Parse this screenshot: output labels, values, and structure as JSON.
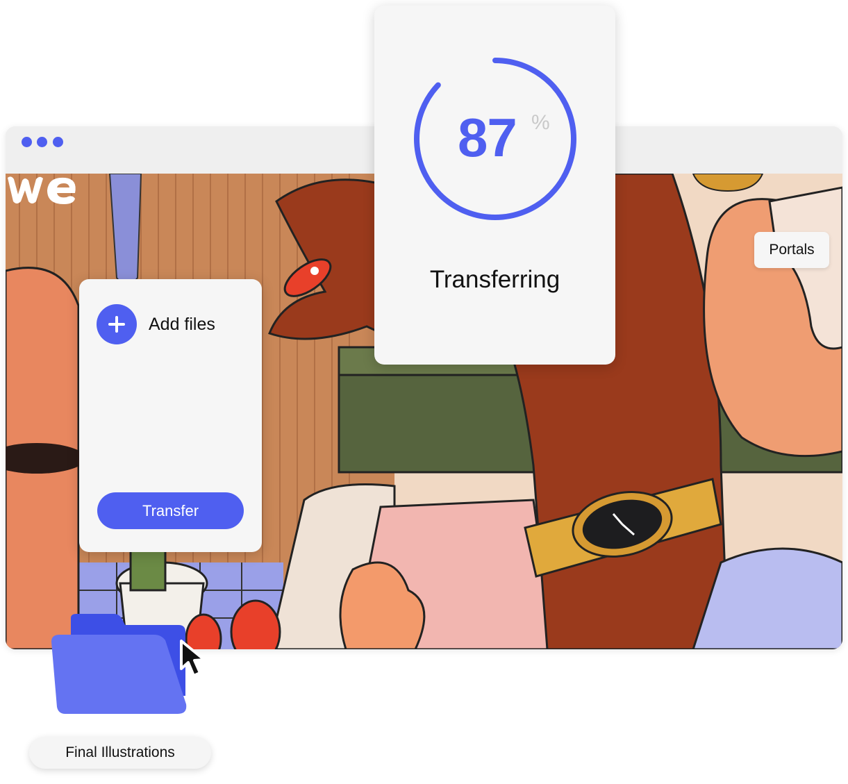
{
  "browser": {
    "window_controls": [
      "dot",
      "dot",
      "dot"
    ]
  },
  "logo": {
    "text": "we"
  },
  "header": {
    "portals_label": "Portals"
  },
  "upload_panel": {
    "add_files_label": "Add files",
    "transfer_label": "Transfer"
  },
  "progress_panel": {
    "percent": "87",
    "percent_sign": "%",
    "progress_fraction": 0.87,
    "status": "Transferring"
  },
  "folder": {
    "label": "Final Illustrations",
    "icon": "folder-icon"
  },
  "colors": {
    "accent": "#4f5ff0",
    "panel": "#f6f6f6",
    "chrome": "#efefef"
  }
}
